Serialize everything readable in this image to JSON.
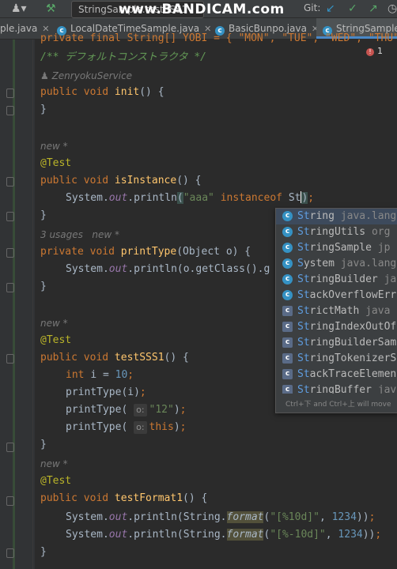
{
  "toolbar": {
    "run_config": "StringSample.testSSS1",
    "watermark": "www.BANDICAM.com",
    "git_label": "Git:"
  },
  "tabs": [
    {
      "label": "ple.java",
      "active": false
    },
    {
      "label": "LocalDateTimeSample.java",
      "active": false
    },
    {
      "label": "BasicBunpo.java",
      "active": false
    },
    {
      "label": "StringSample",
      "active": true
    }
  ],
  "inspection": {
    "error_count": "1"
  },
  "code": {
    "line_field": "private final String[] YOBI = { \"MON\", \"TUE\", \"WED\", \"THU\"",
    "comment": "/** デフォルトコンストラクタ */",
    "author_hint": "ZenryokuService",
    "init_sig": "init",
    "new_hint": "new *",
    "usages_hint": "3 usages",
    "test_annotation": "@Test",
    "isInstance_name": "isInstance",
    "isInstance_str": "\"aaa\"",
    "typed_text": "St",
    "printType_name": "printType",
    "testSSS1_name": "testSSS1",
    "int_value": "10",
    "param_hint": "o:",
    "arg_string": "\"12\"",
    "testFormat1_name": "testFormat1",
    "fmt1": "\"[%10d]\"",
    "fmt2": "\"[%-10d]\"",
    "fmt_num": "1234"
  },
  "completion": {
    "items": [
      {
        "name_hl": "St",
        "name_rest": "ring",
        "pkg": "java.lang",
        "icon": "class-icon"
      },
      {
        "name_hl": "St",
        "name_rest": "ringUtils",
        "pkg": "org",
        "icon": "class-icon"
      },
      {
        "name_hl": "St",
        "name_rest": "ringSample",
        "pkg": "jp",
        "icon": "class-icon"
      },
      {
        "name_hl": "S",
        "name_rest": "ystem",
        "pkg": "java.lang",
        "icon": "class-icon"
      },
      {
        "name_hl": "St",
        "name_rest": "ringBuilder",
        "pkg": "java",
        "icon": "class-icon"
      },
      {
        "name_hl": "St",
        "name_rest": "ackOverflowErr",
        "pkg": "",
        "icon": "class-icon"
      },
      {
        "name_hl": "St",
        "name_rest": "rictMath",
        "pkg": "java",
        "icon": "final-class-icon"
      },
      {
        "name_hl": "St",
        "name_rest": "ringIndexOutOf",
        "pkg": "",
        "icon": "final-class-icon"
      },
      {
        "name_hl": "St",
        "name_rest": "ringBuilderSam",
        "pkg": "",
        "icon": "final-class-icon"
      },
      {
        "name_hl": "St",
        "name_rest": "ringTokenizerS",
        "pkg": "",
        "icon": "final-class-icon"
      },
      {
        "name_hl": "St",
        "name_rest": "ackTraceElemen",
        "pkg": "",
        "icon": "final-class-icon"
      },
      {
        "name_hl": "St",
        "name_rest": "ringBuffer",
        "pkg": "java",
        "icon": "final-class-icon"
      }
    ],
    "footer": "Ctrl+下 and Ctrl+上 will move caret"
  }
}
